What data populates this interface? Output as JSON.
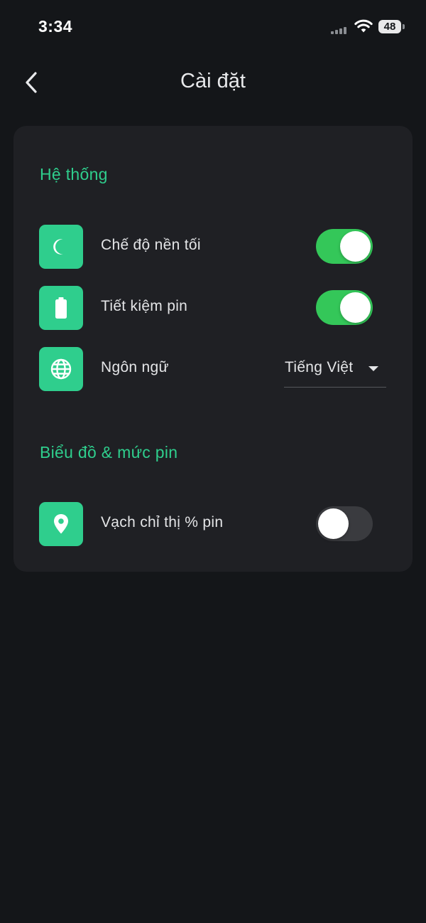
{
  "status_bar": {
    "time": "3:34",
    "battery": "48",
    "icons": [
      "cellular-signal-icon",
      "wifi-icon",
      "battery-icon"
    ]
  },
  "header": {
    "title": "Cài đặt",
    "back_icon": "chevron-left-icon"
  },
  "colors": {
    "background": "#141619",
    "card": "#1f2024",
    "accent": "#2fce8d",
    "toggle_on": "#34c759",
    "toggle_off": "#3a3b3f"
  },
  "sections": [
    {
      "title": "Hệ thống",
      "items": [
        {
          "label": "Chế độ nền tối",
          "icon": "moon-icon",
          "control": "toggle",
          "on": true
        },
        {
          "label": "Tiết kiệm pin",
          "icon": "battery-icon",
          "control": "toggle",
          "on": true
        },
        {
          "label": "Ngôn ngữ",
          "icon": "globe-icon",
          "control": "select",
          "value": "Tiếng Việt"
        }
      ]
    },
    {
      "title": "Biểu đồ & mức pin",
      "items": [
        {
          "label": "Vạch chỉ thị % pin",
          "icon": "location-pin-icon",
          "control": "toggle",
          "on": false
        }
      ]
    }
  ]
}
